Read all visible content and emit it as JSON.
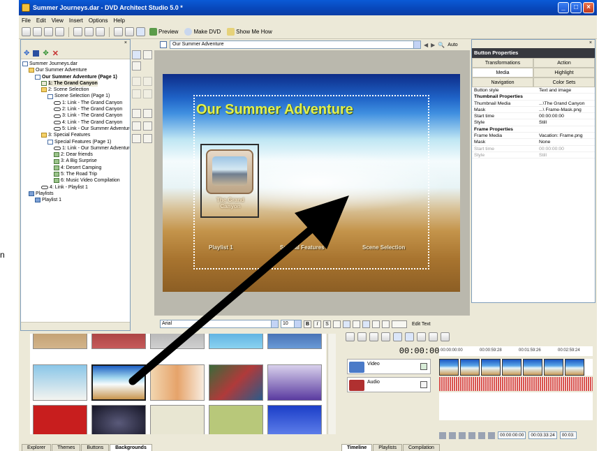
{
  "outside_label": "n",
  "window": {
    "title": "Summer Journeys.dar - DVD Architect Studio 5.0 *",
    "controls": [
      "_",
      "□",
      "×"
    ]
  },
  "menu": [
    "File",
    "Edit",
    "View",
    "Insert",
    "Options",
    "Help"
  ],
  "toolbar": {
    "preview": "Preview",
    "make_dvd": "Make DVD",
    "show_me_how": "Show Me How"
  },
  "explorer": {
    "tree": [
      {
        "label": "Summer Journeys.dar",
        "icon": "project",
        "indent": 0
      },
      {
        "label": "Our Summer Adventure",
        "icon": "folder",
        "indent": 1
      },
      {
        "label": "Our Summer Adventure (Page 1)",
        "icon": "page",
        "indent": 2,
        "bold": true
      },
      {
        "label": "1: The Grand Canyon",
        "icon": "chapter",
        "indent": 3,
        "selected": true
      },
      {
        "label": "2: Scene Selection",
        "icon": "folder",
        "indent": 3
      },
      {
        "label": "Scene Selection (Page 1)",
        "icon": "page",
        "indent": 4
      },
      {
        "label": "1: Link - The Grand Canyon",
        "icon": "link",
        "indent": 5
      },
      {
        "label": "2: Link - The Grand Canyon",
        "icon": "link",
        "indent": 5
      },
      {
        "label": "3: Link - The Grand Canyon",
        "icon": "link",
        "indent": 5
      },
      {
        "label": "4: Link - The Grand Canyon",
        "icon": "link",
        "indent": 5
      },
      {
        "label": "5: Link - Our Summer Adventure",
        "icon": "link",
        "indent": 5
      },
      {
        "label": "3: Special Features",
        "icon": "folder",
        "indent": 3
      },
      {
        "label": "Special Features (Page 1)",
        "icon": "page",
        "indent": 4
      },
      {
        "label": "1: Link - Our Summer Adventure",
        "icon": "link",
        "indent": 5
      },
      {
        "label": "2: Dear friends",
        "icon": "chapter",
        "indent": 5
      },
      {
        "label": "3: A Big Surprise",
        "icon": "chapter",
        "indent": 5
      },
      {
        "label": "4: Desert Camping",
        "icon": "chapter",
        "indent": 5
      },
      {
        "label": "5: The Road Trip",
        "icon": "chapter",
        "indent": 5
      },
      {
        "label": "6: Music Video Compilation",
        "icon": "chapter",
        "indent": 5
      },
      {
        "label": "4: Link - Playlist 1",
        "icon": "link",
        "indent": 3
      },
      {
        "label": "Playlists",
        "icon": "playlist",
        "indent": 1
      },
      {
        "label": "Playlist 1",
        "icon": "playlist",
        "indent": 2
      }
    ]
  },
  "canvas": {
    "page_combo": "Our Summer Adventure",
    "zoom": "Auto",
    "menu_title": "Our Summer Adventure",
    "thumb_label_1": "The Grand",
    "thumb_label_2": "Canyon",
    "links": [
      "Playlist 1",
      "Special Features",
      "Scene Selection"
    ]
  },
  "format": {
    "font": "Arial",
    "size": "10",
    "bold": "B",
    "italic": "I",
    "shadow": "S",
    "edit_text": "Edit Text"
  },
  "properties": {
    "title": "Button Properties",
    "tabs": [
      "Transformations",
      "Action",
      "Media",
      "Highlight",
      "Navigation",
      "Color Sets"
    ],
    "active_tab": "Media",
    "rows": [
      {
        "key": "Button style",
        "value": "Text and image",
        "kind": "row"
      },
      {
        "key": "Thumbnail Properties",
        "value": "",
        "kind": "cat"
      },
      {
        "key": "Thumbnail Media",
        "value": "...\\The Grand Canyon",
        "kind": "row"
      },
      {
        "key": "Mask",
        "value": "...\\ Frame-Mask.png",
        "kind": "row"
      },
      {
        "key": "Start time",
        "value": "00:00:00:00",
        "kind": "row"
      },
      {
        "key": "Style",
        "value": "Still",
        "kind": "row"
      },
      {
        "key": "Frame Properties",
        "value": "",
        "kind": "cat"
      },
      {
        "key": "Frame Media",
        "value": "Vacation: Frame.png",
        "kind": "row"
      },
      {
        "key": "Mask",
        "value": "None",
        "kind": "row"
      },
      {
        "key": "Start time",
        "value": "00:00:00:00",
        "kind": "dim"
      },
      {
        "key": "Style",
        "value": "Still",
        "kind": "dim"
      }
    ]
  },
  "library": {
    "tabs": [
      "Explorer",
      "Themes",
      "Buttons",
      "Backgrounds"
    ],
    "active_tab": "Backgrounds"
  },
  "timeline": {
    "time": "00:00:00:00",
    "video_label": "Video",
    "audio_label": "Audio",
    "ruler": [
      "00:00:00:00",
      "00:00:59:28",
      "00:01:59:26",
      "00:02:59:24"
    ],
    "transport_start": "00:00:00:00",
    "transport_end": "00:03:33:24",
    "transport_extra": "00:03:",
    "tabs": [
      "Timeline",
      "Playlists",
      "Compilation"
    ],
    "active_tab": "Timeline"
  }
}
